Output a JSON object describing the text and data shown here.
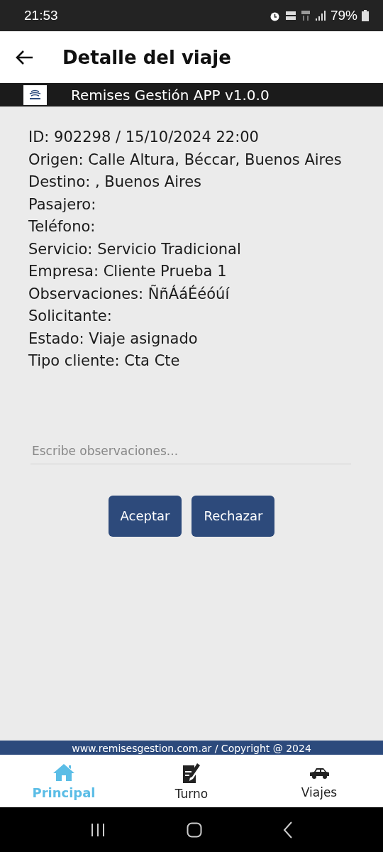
{
  "status_bar": {
    "time": "21:53",
    "battery": "79%"
  },
  "header": {
    "title": "Detalle del viaje"
  },
  "banner": {
    "title": "Remises Gestión APP v1.0.0"
  },
  "details": [
    "ID: 902298 / 15/10/2024 22:00",
    "Origen: Calle Altura, Béccar, Buenos Aires",
    "Destino: , Buenos Aires",
    "Pasajero:",
    "Teléfono:",
    "Servicio: Servicio Tradicional",
    "Empresa: Cliente Prueba 1",
    "Observaciones: ÑñÁáÉéóúí",
    "Solicitante:",
    "Estado: Viaje asignado",
    "Tipo cliente: Cta Cte"
  ],
  "observations": {
    "placeholder": "Escribe observaciones..."
  },
  "buttons": [
    "Aceptar",
    "Rechazar"
  ],
  "footer": "www.remisesgestion.com.ar / Copyright @ 2024",
  "nav": [
    {
      "kind": "home",
      "label": "Principal",
      "selected": true
    },
    {
      "kind": "note",
      "label": "Turno",
      "selected": false
    },
    {
      "kind": "car",
      "label": "Viajes",
      "selected": false
    }
  ]
}
